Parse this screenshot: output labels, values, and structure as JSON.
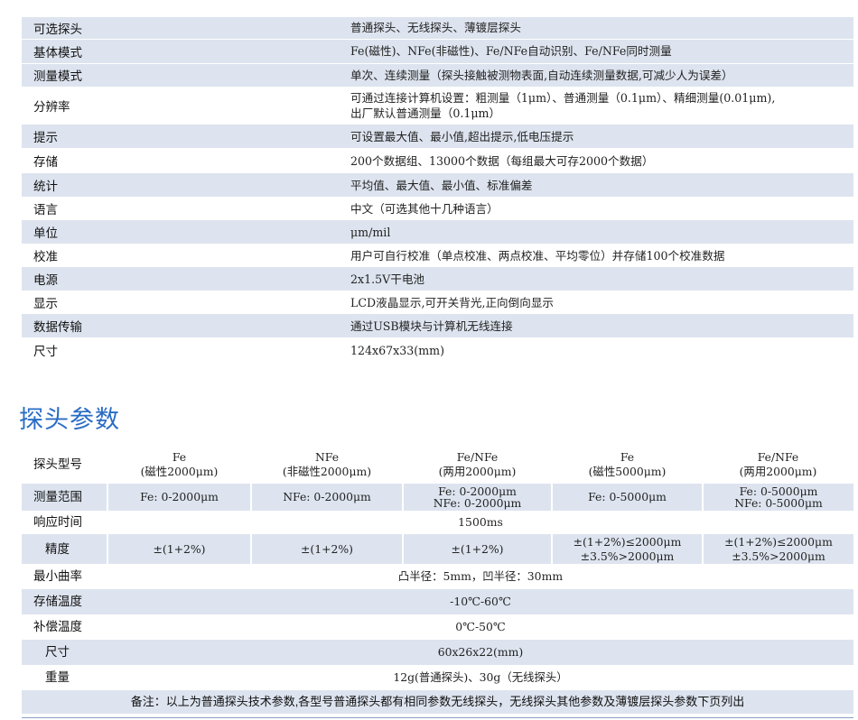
{
  "specs": [
    {
      "label": "可选探头",
      "value": "普通探头、无线探头、薄镀层探头"
    },
    {
      "label": "基体模式",
      "value": "Fe(磁性)、NFe(非磁性)、Fe/NFe自动识别、Fe/NFe同时测量"
    },
    {
      "label": "测量模式",
      "value": "单次、连续测量（探头接触被测物表面,自动连续测量数据,可减少人为误差）"
    },
    {
      "label": "分辨率",
      "value_line1": "可通过连接计算机设置：粗测量（1μm）、普通测量（0.1μm）、精细测量(0.01μm),",
      "value_line2": "出厂默认普通测量（0.1μm）"
    },
    {
      "label": "提示",
      "value": "可设置最大值、最小值,超出提示,低电压提示"
    },
    {
      "label": "存储",
      "value": "200个数据组、13000个数据（每组最大可存2000个数据）"
    },
    {
      "label": "统计",
      "value": "平均值、最大值、最小值、标准偏差"
    },
    {
      "label": "语言",
      "value": "中文（可选其他十几种语言）"
    },
    {
      "label": "单位",
      "value": "μm/mil"
    },
    {
      "label": "校准",
      "value": "用户可自行校准（单点校准、两点校准、平均零位）并存储100个校准数据"
    },
    {
      "label": "电源",
      "value": "2x1.5V干电池"
    },
    {
      "label": "显示",
      "value": "LCD液晶显示,可开关背光,正向倒向显示"
    },
    {
      "label": "数据传输",
      "value": "通过USB模块与计算机无线连接"
    },
    {
      "label": "尺寸",
      "value": "124x67x33(mm)"
    }
  ],
  "probe_section_title": "探头参数",
  "probe_table": {
    "model_label": "探头型号",
    "models": [
      {
        "name": "Fe",
        "sub": "(磁性2000μm)"
      },
      {
        "name": "NFe",
        "sub": "(非磁性2000μm)"
      },
      {
        "name": "Fe/NFe",
        "sub": "(两用2000μm)"
      },
      {
        "name": "Fe",
        "sub": "(磁性5000μm)"
      },
      {
        "name": "Fe/NFe",
        "sub": "(两用2000μm)"
      }
    ],
    "range_label": "测量范围",
    "ranges": [
      {
        "line1": "Fe: 0-2000μm"
      },
      {
        "line1": "NFe: 0-2000μm"
      },
      {
        "line1": "Fe: 0-2000μm",
        "line2": "NFe: 0-2000μm"
      },
      {
        "line1": "Fe: 0-5000μm"
      },
      {
        "line1": "Fe: 0-5000μm",
        "line2": "NFe: 0-5000μm"
      }
    ],
    "response_label": "响应时间",
    "response_value": "1500ms",
    "accuracy_label": "精度",
    "accuracy": [
      {
        "line1": "±(1+2%)"
      },
      {
        "line1": "±(1+2%)"
      },
      {
        "line1": "±(1+2%)"
      },
      {
        "line1": "±(1+2%)≤2000μm",
        "line2": "±3.5%>2000μm"
      },
      {
        "line1": "±(1+2%)≤2000μm",
        "line2": "±3.5%>2000μm"
      }
    ],
    "curvature_label": "最小曲率",
    "curvature_value": "凸半径：5mm，凹半径：30mm",
    "storage_temp_label": "存储温度",
    "storage_temp_value": "-10℃-60℃",
    "comp_temp_label": "补偿温度",
    "comp_temp_value": "0℃-50℃",
    "size_label": "尺寸",
    "size_value": "60x26x22(mm)",
    "weight_label": "重量",
    "weight_value": "12g(普通探头)、30g（无线探头）",
    "note": "备注：以上为普通探头技术参数,各型号普通探头都有相同参数无线探头，无线探头其他参数及薄镀层探头参数下页列出"
  },
  "colors": {
    "row_shade": "#dde4ef",
    "title_blue": "#2a6cc4"
  }
}
